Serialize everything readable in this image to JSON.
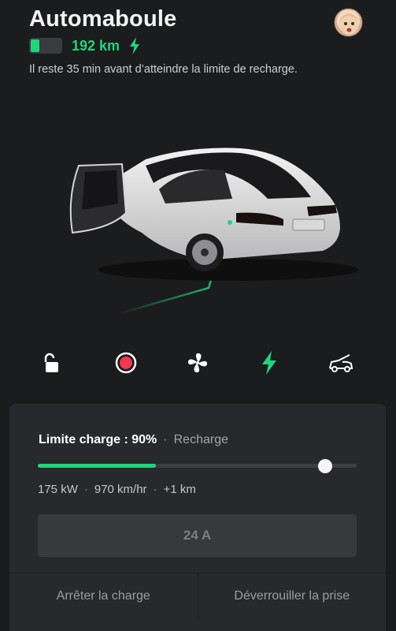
{
  "header": {
    "title": "Automaboule",
    "range": "192 km",
    "battery_level": 0.3,
    "message": "Il reste 35 min avant d’atteindre la limite de recharge."
  },
  "colors": {
    "accent": "#1fd67a",
    "background": "#1b1c1e",
    "panel": "#28292c",
    "record": "#f2374f"
  },
  "controls": [
    {
      "name": "lock",
      "icon": "unlock-icon"
    },
    {
      "name": "sentry",
      "icon": "record-icon"
    },
    {
      "name": "climate",
      "icon": "fan-icon"
    },
    {
      "name": "charging",
      "icon": "bolt-icon"
    },
    {
      "name": "trunk",
      "icon": "trunk-icon"
    }
  ],
  "charge": {
    "limit_label": "Limite charge : 90%",
    "state": "Recharge",
    "current_level": 0.37,
    "limit_level": 0.9,
    "power": "175 kW",
    "rate": "970 km/hr",
    "added": "+1 km",
    "amperage": "24 A"
  },
  "actions": {
    "stop": "Arrêter la charge",
    "unlock_port": "Déverrouiller la prise"
  }
}
